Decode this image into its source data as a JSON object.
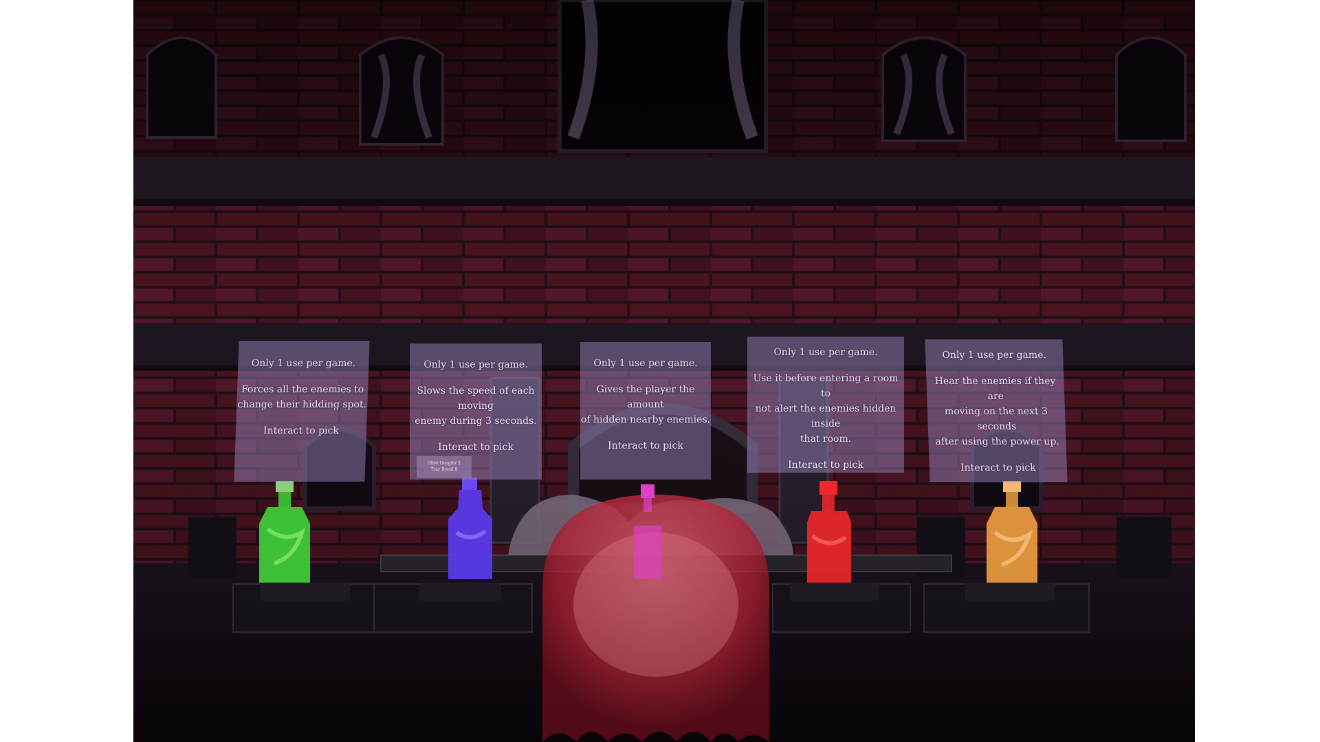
{
  "panels": [
    {
      "header": "Only 1 use per game.",
      "description": "Forces all the enemies to\nchange their hidding spot.",
      "action": "Interact to pick",
      "potion_color": "#3fd43a"
    },
    {
      "header": "Only 1 use per game.",
      "description": "Slows the speed of each moving\nenemy during 3 seconds.",
      "action": "Interact to pick",
      "potion_color": "#5b3bef"
    },
    {
      "header": "Only 1 use per game.",
      "description": "Gives the player the amount\nof hidden nearby enemies.",
      "action": "Interact to pick",
      "potion_color": "#e040c8"
    },
    {
      "header": "Only 1 use per game.",
      "description": "Use it before entering a room to\nnot alert the enemies hidden inside\nthat room.",
      "action": "Interact to pick",
      "potion_color": "#f0282a"
    },
    {
      "header": "Only 1 use per game.",
      "description": "Hear the enemies if they are\nmoving on the next 3 seconds\nafter using the power up.",
      "action": "Interact to pick",
      "potion_color": "#f0a040"
    }
  ],
  "sign": {
    "line1": "Olivé Gengibr 2",
    "line2": "Tráz Brasil 8"
  },
  "colors": {
    "wall_brick": "#4a1420",
    "mortar": "#22101a",
    "ghost": "#e8304c",
    "panel_bg": "#9682b9"
  }
}
